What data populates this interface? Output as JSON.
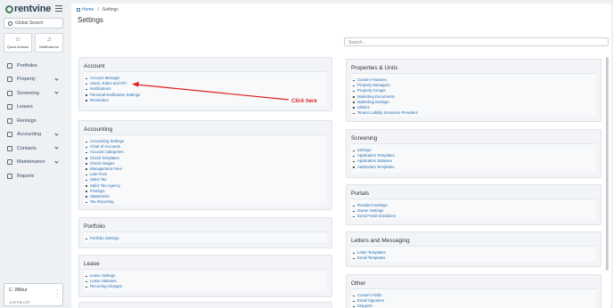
{
  "brand": {
    "name": "rentvine"
  },
  "sidebar": {
    "search_placeholder": "Global Search",
    "quick_actions": [
      {
        "label": "Quick Actions",
        "icon": "person-plus-icon"
      },
      {
        "label": "Notifications",
        "icon": "bell-icon"
      }
    ],
    "items": [
      {
        "label": "Portfolios",
        "icon": "folder-icon",
        "chevron": false
      },
      {
        "label": "Property",
        "icon": "building-icon",
        "chevron": true
      },
      {
        "label": "Screening",
        "icon": "clipboard-icon",
        "chevron": true
      },
      {
        "label": "Leases",
        "icon": "document-icon",
        "chevron": false
      },
      {
        "label": "Rentsign",
        "icon": "signature-icon",
        "chevron": false
      },
      {
        "label": "Accounting",
        "icon": "dollar-icon",
        "chevron": true
      },
      {
        "label": "Contacts",
        "icon": "contact-card-icon",
        "chevron": true
      },
      {
        "label": "Maintenance",
        "icon": "wrench-icon",
        "chevron": true
      },
      {
        "label": "Reports",
        "icon": "report-icon",
        "chevron": false
      }
    ],
    "user": {
      "name": "C. Wilbur",
      "time": "1:23 PM CST"
    }
  },
  "breadcrumb": {
    "home": "Home",
    "current": "Settings"
  },
  "page_title": "Settings",
  "settings_search_placeholder": "Search...",
  "left_cards": [
    {
      "title": "Account",
      "links": [
        "Account Manager",
        "Users, Roles and API",
        "Notifications",
        "Personal Notification Settings",
        "Reminders"
      ]
    },
    {
      "title": "Accounting",
      "links": [
        "Accounting Settings",
        "Chart of Accounts",
        "Account Categories",
        "Check Templates",
        "Check Images",
        "Management Fees",
        "Late Fees",
        "Sales Tax",
        "Sales Tax Agency",
        "Postings",
        "Statements",
        "Tax Reporting"
      ]
    },
    {
      "title": "Portfolio",
      "links": [
        "Portfolio Settings"
      ]
    },
    {
      "title": "Lease",
      "links": [
        "Lease Settings",
        "Lease Statuses",
        "Recurring Charges"
      ]
    }
  ],
  "right_cards": [
    {
      "title": "Properties & Units",
      "links": [
        "Custom Features",
        "Property Managers",
        "Property Groups",
        "Marketing Documents",
        "Marketing Settings",
        "Utilities",
        "Tenant Liability Insurance Providers"
      ]
    },
    {
      "title": "Screening",
      "links": [
        "Settings",
        "Application Templates",
        "Application Statuses",
        "Addendum Templates"
      ]
    },
    {
      "title": "Portals",
      "links": [
        "Resident Settings",
        "Owner Settings",
        "Send Portal Invitations"
      ]
    },
    {
      "title": "Letters and Messaging",
      "links": [
        "Letter Templates",
        "Email Templates"
      ]
    },
    {
      "title": "Other",
      "links": [
        "Custom Fields",
        "Email Signature",
        "Snippets"
      ]
    }
  ],
  "annotation": {
    "text": "Click here",
    "color": "#e02020"
  }
}
